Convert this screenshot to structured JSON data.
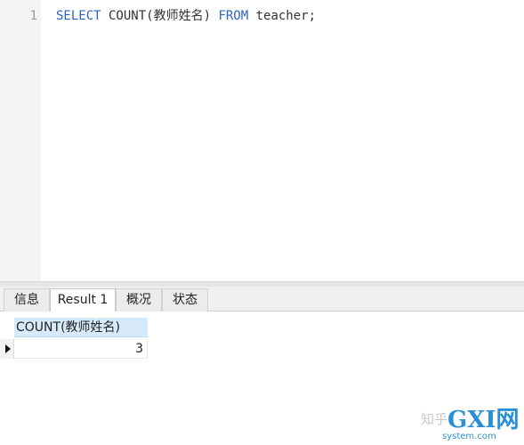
{
  "editor": {
    "line_number": "1",
    "sql": {
      "select_kw": "SELECT",
      "count_expr": " COUNT(教师姓名) ",
      "from_kw": "FROM",
      "table": " teacher;"
    }
  },
  "tabs": [
    {
      "label": "信息",
      "active": false
    },
    {
      "label": "Result 1",
      "active": true
    },
    {
      "label": "概况",
      "active": false
    },
    {
      "label": "状态",
      "active": false
    }
  ],
  "result": {
    "columns": [
      "COUNT(教师姓名)"
    ],
    "rows": [
      [
        "3"
      ]
    ]
  },
  "watermark": {
    "prefix": "知乎",
    "brand": "GXI网",
    "domain": "system.com"
  },
  "colors": {
    "keyword": "#2a62c9",
    "header_bg": "#d6eaf9",
    "watermark_blue": "#2b8fd6"
  }
}
